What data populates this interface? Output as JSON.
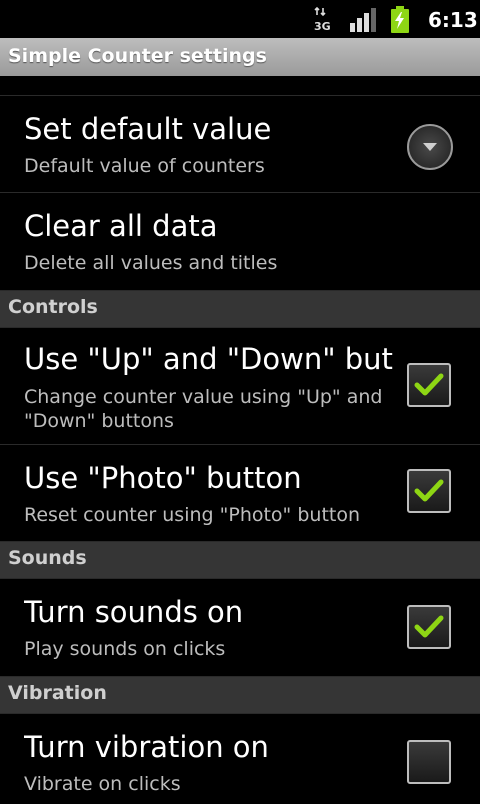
{
  "status_bar": {
    "network_label": "3G",
    "time": "6:13",
    "battery_color": "#8ed614"
  },
  "app_title": "Simple Counter settings",
  "preferences": [
    {
      "title": "Set default value",
      "summary": "Default value of counters",
      "widget": "dropdown"
    },
    {
      "title": "Clear all data",
      "summary": "Delete all values and titles",
      "widget": "none"
    }
  ],
  "categories": [
    {
      "title": "Controls",
      "items": [
        {
          "title": "Use \"Up\" and \"Down\" but",
          "summary": "Change counter value using \"Up\" and \"Down\" buttons",
          "checked": true
        },
        {
          "title": "Use \"Photo\" button",
          "summary": "Reset counter using \"Photo\" button",
          "checked": true
        }
      ]
    },
    {
      "title": "Sounds",
      "items": [
        {
          "title": "Turn sounds on",
          "summary": "Play sounds on clicks",
          "checked": true
        }
      ]
    },
    {
      "title": "Vibration",
      "items": [
        {
          "title": "Turn vibration on",
          "summary": "Vibrate on clicks",
          "checked": false
        }
      ]
    }
  ],
  "colors": {
    "check_mark": "#8ed614",
    "category_bg": "#353535",
    "title_bar": "#a8a8a8"
  }
}
